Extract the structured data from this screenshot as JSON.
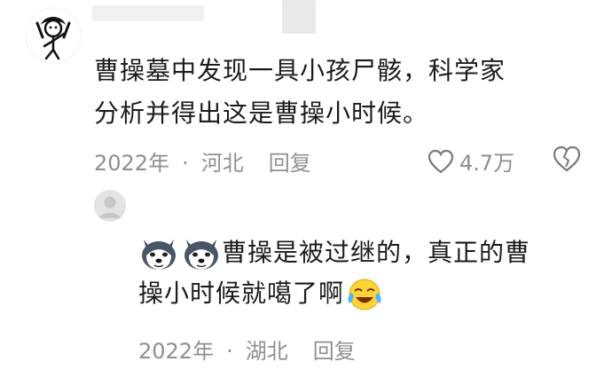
{
  "comment": {
    "text_line1": "曹操墓中发现一具小孩尸骸，科学家",
    "text_line2": "分析并得出这是曹操小时候。",
    "meta": {
      "date": "2022年",
      "sep": "·",
      "location": "河北",
      "reply_label": "回复"
    },
    "likes": "4.7万",
    "icons": {
      "avatar": "stick-figure-avatar",
      "like": "heart-outline-icon",
      "dislike": "broken-heart-icon"
    }
  },
  "reply": {
    "text_line1": "曹操是被过继的，真正的曹",
    "text_line2": "操小时候就噶了啊",
    "meta": {
      "date": "2022年",
      "sep": "·",
      "location": "湖北",
      "reply_label": "回复"
    },
    "icons": {
      "avatar": "default-user-avatar",
      "emojis_before": [
        "husky-emoji",
        "husky-emoji"
      ],
      "emoji_after": "crying-laughing-emoji"
    }
  },
  "colors": {
    "meta_text": "#8f8f8f",
    "body_text": "#1c1c1c"
  }
}
